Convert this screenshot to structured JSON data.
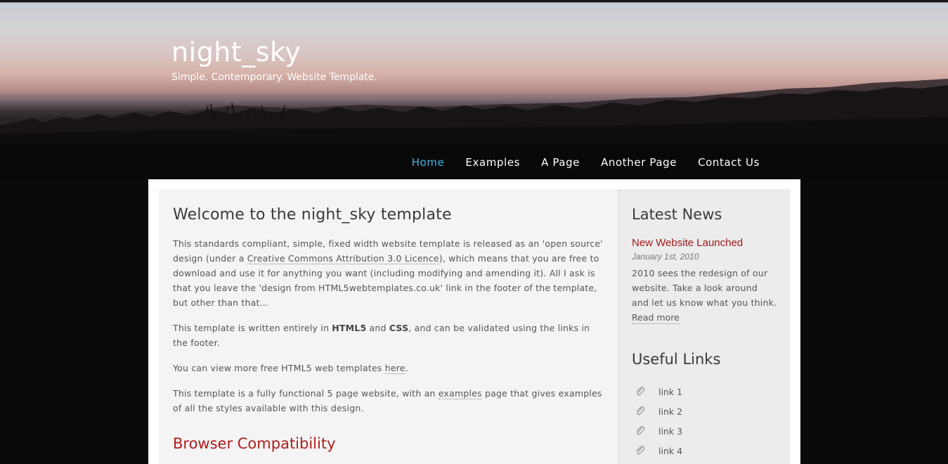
{
  "header": {
    "title": "night_sky",
    "slogan": "Simple. Contemporary. Website Template."
  },
  "menu": {
    "items": [
      {
        "label": "Home",
        "selected": true
      },
      {
        "label": "Examples"
      },
      {
        "label": "A Page"
      },
      {
        "label": "Another Page"
      },
      {
        "label": "Contact Us"
      }
    ]
  },
  "content": {
    "heading": "Welcome to the night_sky template",
    "p1": {
      "before": "This standards compliant, simple, fixed width website template is released as an 'open source' design (under a ",
      "link": "Creative Commons Attribution 3.0 Licence",
      "after": "), which means that you are free to download and use it for anything you want (including modifying and amending it). All I ask is that you leave the 'design from HTML5webtemplates.co.uk' link in the footer of the template, but other than that..."
    },
    "p2": {
      "before": "This template is written entirely in ",
      "bold1": "HTML5",
      "mid": " and ",
      "bold2": "CSS",
      "after": ", and can be validated using the links in the footer."
    },
    "p3": {
      "before": "You can view more free HTML5 web templates ",
      "link": "here",
      "after": "."
    },
    "p4": {
      "before": "This template is a fully functional 5 page website, with an ",
      "link": "examples",
      "after": " page that gives examples of all the styles available with this design."
    },
    "subheading": "Browser Compatibility"
  },
  "sidebar": {
    "news_heading": "Latest News",
    "news_title": "New Website Launched",
    "news_date": "January 1st, 2010",
    "news_text": "2010 sees the redesign of our website. Take a look around and let us know what you think.",
    "read_more": "Read more",
    "links_heading": "Useful Links",
    "links": [
      {
        "label": "link 1",
        "icon": "paperclip-icon"
      },
      {
        "label": "link 2",
        "icon": "paperclip-icon"
      },
      {
        "label": "link 3",
        "icon": "paperclip-icon"
      },
      {
        "label": "link 4",
        "icon": "paperclip-icon"
      }
    ]
  },
  "colors": {
    "menu_selected": "#3fb4e6",
    "accent_red": "#b01c1c",
    "page_bg": "#0b0a0a"
  }
}
